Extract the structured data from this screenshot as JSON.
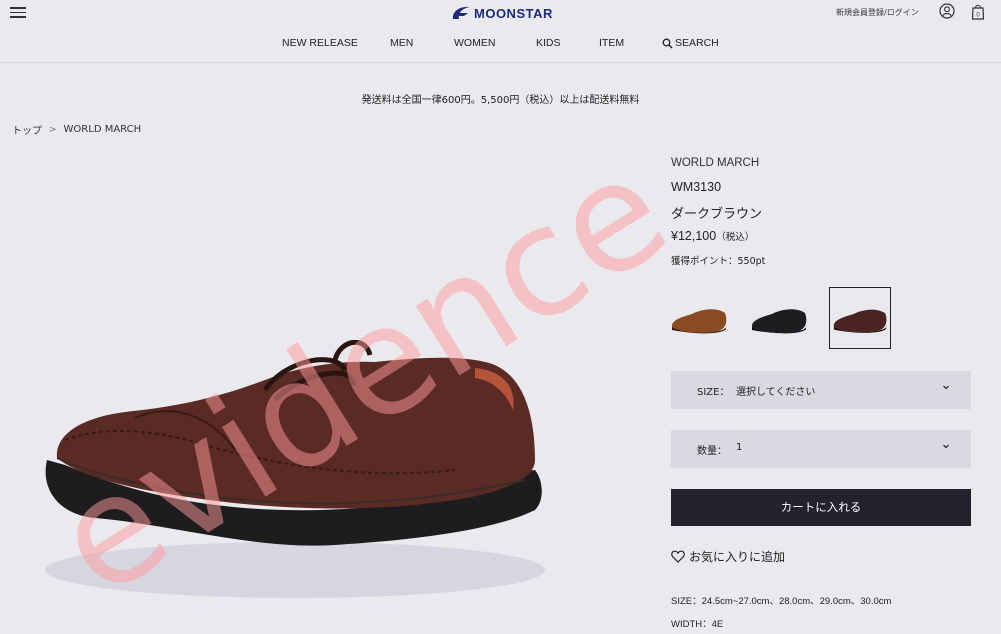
{
  "header": {
    "logo_text": "MOONSTAR",
    "login_link": "新規会員登録/ログイン"
  },
  "nav": {
    "items": [
      "NEW RELEASE",
      "MEN",
      "WOMEN",
      "KIDS",
      "ITEM"
    ],
    "search_label": "SEARCH"
  },
  "notice": "発送料は全国一律600円。5,500円（税込）以上は配送料無料",
  "breadcrumb": {
    "home": "トップ",
    "separator": ">",
    "current": "WORLD MARCH"
  },
  "product": {
    "brand": "WORLD MARCH",
    "model": "WM3130",
    "color": "ダークブラウン",
    "price": "¥12,100",
    "tax_note": "（税込）",
    "points": "獲得ポイント：550pt"
  },
  "swatches": [
    {
      "name": "brown",
      "color": "#8a4a22",
      "selected": false
    },
    {
      "name": "black",
      "color": "#1d1d1f",
      "selected": false
    },
    {
      "name": "dark-brown",
      "color": "#4a2420",
      "selected": true
    }
  ],
  "size_select": {
    "label": "SIZE：",
    "value": "選択してください"
  },
  "qty_select": {
    "label": "数量：",
    "value": "1"
  },
  "cart_button": "カートに入れる",
  "favorite_label": "お気に入りに追加",
  "specs": {
    "size": "SIZE：24.5cm~27.0cm、28.0cm、29.0cm、30.0cm",
    "width": "WIDTH：4E"
  },
  "watermark": "evidence",
  "colors": {
    "background": "#e9e9ee",
    "brand_blue": "#1c2c7a",
    "cart_button": "#22232f",
    "select_bg": "#d9d9e2",
    "watermark": "#ff9a9a"
  }
}
